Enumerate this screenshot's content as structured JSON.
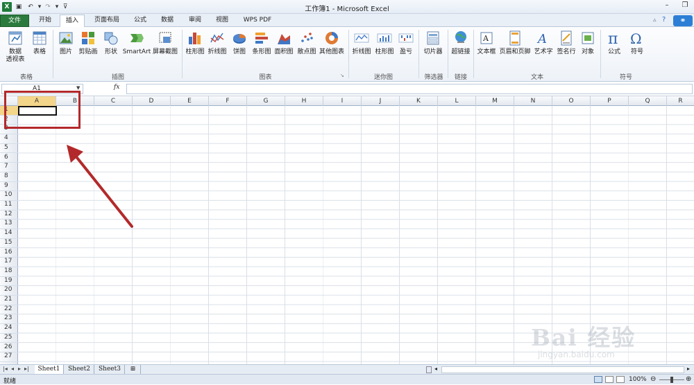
{
  "window": {
    "title": "工作簿1 - Microsoft Excel"
  },
  "tabs": [
    "文件",
    "开始",
    "插入",
    "页面布局",
    "公式",
    "数据",
    "审阅",
    "视图",
    "WPS PDF"
  ],
  "ribbon": {
    "buttons": {
      "pivot": "数据\n透视表",
      "table": "表格",
      "picture": "图片",
      "clipart": "剪贴画",
      "shapes": "形状",
      "smartart": "SmartArt",
      "screenshot": "屏幕截图",
      "col_chart": "柱形图",
      "line_chart": "折线图",
      "pie_chart": "饼图",
      "bar_chart": "条形图",
      "area_chart": "面积图",
      "scatter_chart": "散点图",
      "other_chart": "其他图表",
      "spark_line": "折线图",
      "spark_col": "柱形图",
      "spark_winloss": "盈亏",
      "slicer": "切片器",
      "hyperlink": "超链接",
      "textbox": "文本框",
      "header_footer": "页眉和页脚",
      "wordart": "艺术字",
      "signature": "签名行",
      "object": "对象",
      "equation": "公式",
      "symbol": "符号"
    },
    "groups": {
      "tables": "表格",
      "illustrations": "插图",
      "charts": "图表",
      "sparklines": "迷你图",
      "filter": "筛选器",
      "links": "链接",
      "text": "文本",
      "symbols": "符号"
    }
  },
  "formula": {
    "name_box": "A1",
    "fx": "fx",
    "value": ""
  },
  "columns": [
    "A",
    "B",
    "C",
    "D",
    "E",
    "F",
    "G",
    "H",
    "I",
    "J",
    "K",
    "L",
    "M",
    "N",
    "O",
    "P",
    "Q",
    "R"
  ],
  "rows": [
    "1",
    "2",
    "3",
    "4",
    "5",
    "6",
    "7",
    "8",
    "9",
    "10",
    "11",
    "12",
    "13",
    "14",
    "15",
    "16",
    "17",
    "18",
    "19",
    "20",
    "21",
    "22",
    "23",
    "24",
    "25",
    "26",
    "27"
  ],
  "sheets": [
    "Sheet1",
    "Sheet2",
    "Sheet3"
  ],
  "status": {
    "ready": "就绪",
    "zoom": "100%"
  },
  "watermark": {
    "main": "Bai 经验",
    "sub": "jingyan.baidu.com"
  },
  "colors": {
    "accent": "#2b7a3d",
    "highlight": "#b3292b"
  }
}
